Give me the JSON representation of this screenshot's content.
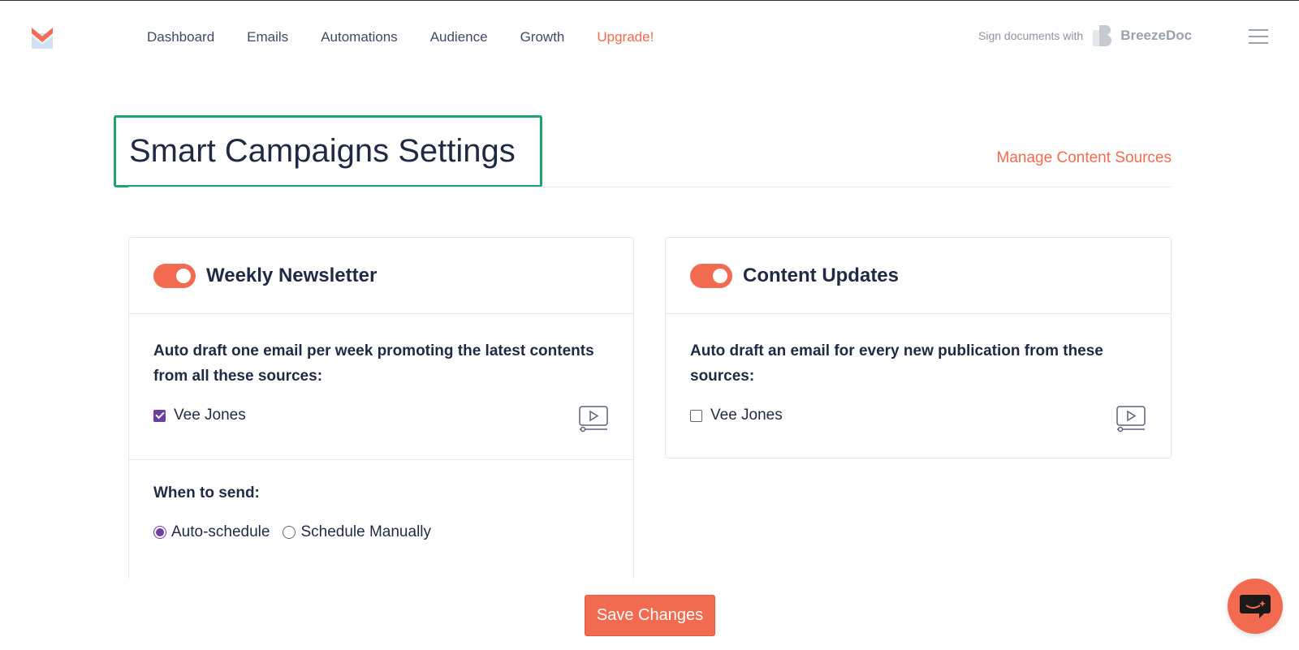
{
  "nav": {
    "items": [
      {
        "label": "Dashboard"
      },
      {
        "label": "Emails"
      },
      {
        "label": "Automations"
      },
      {
        "label": "Audience"
      },
      {
        "label": "Growth"
      },
      {
        "label": "Upgrade!"
      }
    ],
    "sign_text": "Sign documents with",
    "brand_name": "BreezeDoc"
  },
  "page": {
    "title": "Smart Campaigns Settings",
    "manage_link": "Manage Content Sources"
  },
  "weekly": {
    "title": "Weekly Newsletter",
    "enabled": true,
    "description": "Auto draft one email per week promoting the latest contents from all these sources:",
    "source_label": "Vee Jones",
    "source_checked": true,
    "when_label": "When to send:",
    "radio_auto": "Auto-schedule",
    "radio_manual": "Schedule Manually",
    "selected_schedule": "Auto-schedule"
  },
  "updates": {
    "title": "Content Updates",
    "enabled": true,
    "description": "Auto draft an email for every new publication from these sources:",
    "source_label": "Vee Jones",
    "source_checked": false
  },
  "footer": {
    "save_label": "Save Changes"
  },
  "colors": {
    "accent": "#f26a4f",
    "highlight": "#1ea36a",
    "check": "#6b3fa0"
  }
}
